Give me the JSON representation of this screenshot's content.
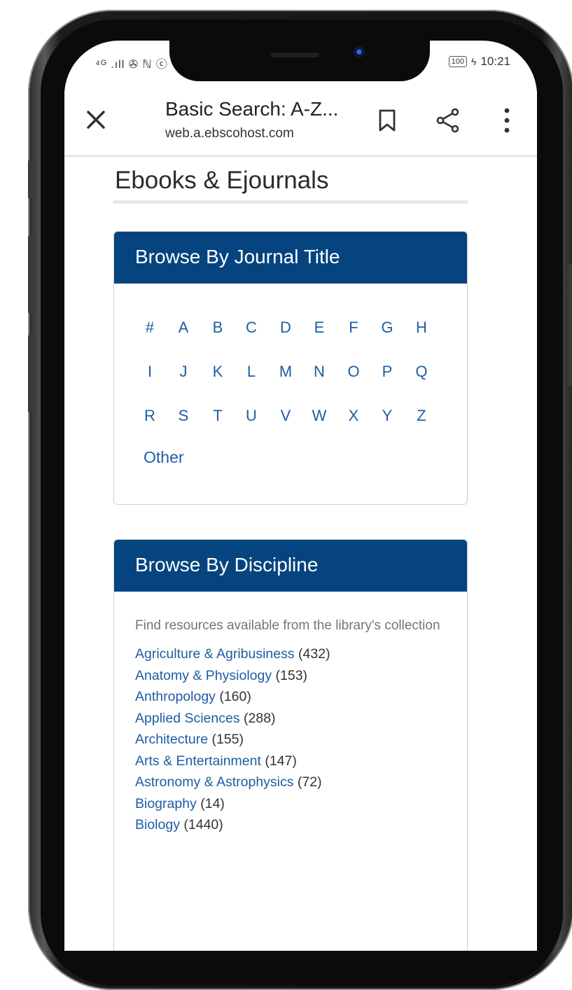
{
  "status_bar": {
    "left": "⁴ᴳ .ıll ✇ ℕ ⓒ",
    "battery": "100",
    "time": "10:21"
  },
  "browser": {
    "title": "Basic Search: A-Z...",
    "url": "web.a.ebscohost.com"
  },
  "page": {
    "title": "Ebooks & Ejournals"
  },
  "browse_title": {
    "header": "Browse By Journal Title",
    "letters": [
      "#",
      "A",
      "B",
      "C",
      "D",
      "E",
      "F",
      "G",
      "H",
      "I",
      "J",
      "K",
      "L",
      "M",
      "N",
      "O",
      "P",
      "Q",
      "R",
      "S",
      "T",
      "U",
      "V",
      "W",
      "X",
      "Y",
      "Z"
    ],
    "other": "Other"
  },
  "browse_discipline": {
    "header": "Browse By Discipline",
    "intro": "Find resources available from the library's collection",
    "items": [
      {
        "name": "Agriculture & Agribusiness",
        "count": "(432)"
      },
      {
        "name": "Anatomy & Physiology",
        "count": "(153)"
      },
      {
        "name": "Anthropology",
        "count": "(160)"
      },
      {
        "name": "Applied Sciences",
        "count": "(288)"
      },
      {
        "name": "Architecture",
        "count": "(155)"
      },
      {
        "name": "Arts & Entertainment",
        "count": "(147)"
      },
      {
        "name": "Astronomy & Astrophysics",
        "count": "(72)"
      },
      {
        "name": "Biography",
        "count": "(14)"
      },
      {
        "name": "Biology",
        "count": "(1440)"
      }
    ]
  },
  "colors": {
    "header_blue": "#05447f",
    "link_blue": "#1e5da3"
  }
}
